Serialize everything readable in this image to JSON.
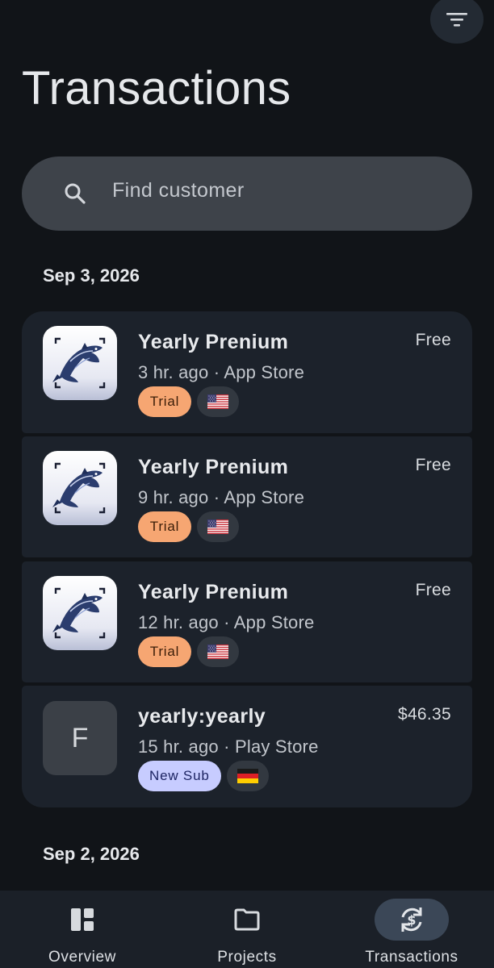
{
  "header": {
    "title": "Transactions",
    "filter_icon": "filter-list-icon"
  },
  "search": {
    "placeholder": "Find customer",
    "icon": "search-icon"
  },
  "groups": [
    {
      "date": "Sep 3, 2026",
      "transactions": [
        {
          "title": "Yearly Prenium",
          "time": "3 hr. ago",
          "store": "App Store",
          "subtitle": "3 hr. ago · App Store",
          "price": "Free",
          "badge": "Trial",
          "flag": "US",
          "icon": "fish-app-icon"
        },
        {
          "title": "Yearly Prenium",
          "time": "9 hr. ago",
          "store": "App Store",
          "subtitle": "9 hr. ago · App Store",
          "price": "Free",
          "badge": "Trial",
          "flag": "US",
          "icon": "fish-app-icon"
        },
        {
          "title": "Yearly Prenium",
          "time": "12 hr. ago",
          "store": "App Store",
          "subtitle": "12 hr. ago · App Store",
          "price": "Free",
          "badge": "Trial",
          "flag": "US",
          "icon": "fish-app-icon"
        },
        {
          "title": "yearly:yearly",
          "time": "15 hr. ago",
          "store": "Play Store",
          "subtitle": "15 hr. ago · Play Store",
          "price": "$46.35",
          "badge": "New Sub",
          "flag": "DE",
          "avatar_letter": "F"
        }
      ]
    },
    {
      "date": "Sep 2, 2026",
      "transactions": []
    }
  ],
  "bottom_nav": {
    "items": [
      {
        "label": "Overview",
        "icon": "dashboard-icon",
        "active": false
      },
      {
        "label": "Projects",
        "icon": "folder-icon",
        "active": false
      },
      {
        "label": "Transactions",
        "icon": "currency-exchange-icon",
        "active": true
      }
    ]
  },
  "colors": {
    "background": "#111418",
    "card": "#1c222b",
    "search_bg": "#3e434a",
    "trial_badge": "#f6a672",
    "new_sub_badge": "#c7ccff",
    "nav_active": "#3b4757"
  }
}
